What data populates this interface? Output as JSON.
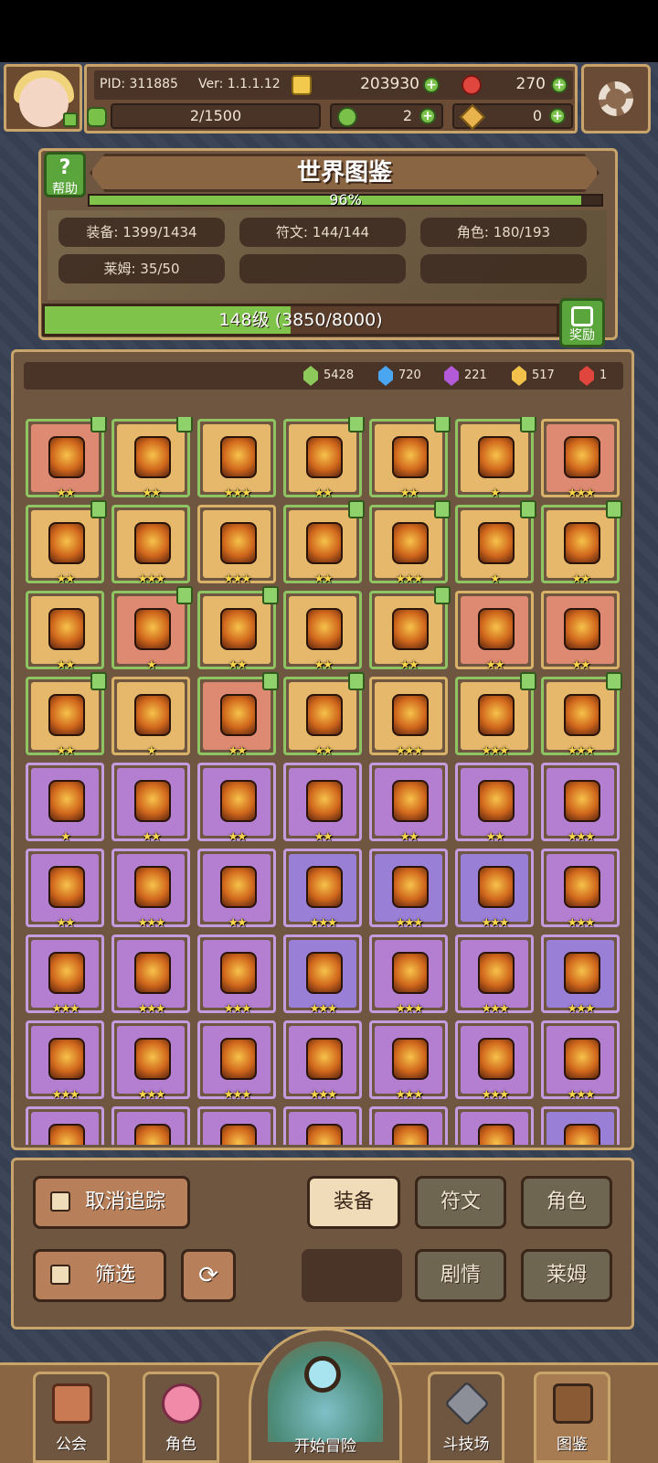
{
  "hud": {
    "pid": "PID: 311885",
    "version": "Ver: 1.1.1.12",
    "gold": "203930",
    "ruby": "270",
    "energy": "2/1500",
    "clover": "2",
    "keys": "0"
  },
  "encyclopedia": {
    "title": "世界图鉴",
    "help_label": "帮助",
    "completion": "96%",
    "completion_value": 0.96,
    "stats": {
      "equipment": "装备: 1399/1434",
      "runes": "符文: 144/144",
      "characters": "角色: 180/193",
      "slime": "莱姆: 35/50"
    },
    "level_text": "148级  (3850/8000)",
    "level_progress": 0.48,
    "reward_label": "奖励"
  },
  "shards": [
    {
      "name": "green-shard",
      "value": "5428",
      "color": "#8dc85a"
    },
    {
      "name": "blue-shard",
      "value": "720",
      "color": "#4aa6f0"
    },
    {
      "name": "purple-shard",
      "value": "221",
      "color": "#b35ad8"
    },
    {
      "name": "gold-shard",
      "value": "517",
      "color": "#f2c14a"
    },
    {
      "name": "red-shard",
      "value": "1",
      "color": "#e0463d"
    }
  ],
  "grid": {
    "rows": [
      [
        {
          "bg": "red",
          "bd": "green",
          "stars": "★★",
          "tag": true
        },
        {
          "bg": "gold",
          "bd": "green",
          "stars": "★★",
          "tag": true
        },
        {
          "bg": "gold",
          "bd": "green",
          "stars": "★★★",
          "tag": false
        },
        {
          "bg": "gold",
          "bd": "green",
          "stars": "★★",
          "tag": true
        },
        {
          "bg": "gold",
          "bd": "green",
          "stars": "★★",
          "tag": true
        },
        {
          "bg": "gold",
          "bd": "green",
          "stars": "★",
          "tag": true
        },
        {
          "bg": "red",
          "bd": "gold",
          "stars": "★★★",
          "tag": false
        }
      ],
      [
        {
          "bg": "gold",
          "bd": "green",
          "stars": "★★",
          "tag": true
        },
        {
          "bg": "gold",
          "bd": "green",
          "stars": "★★★",
          "tag": false
        },
        {
          "bg": "gold",
          "bd": "gold",
          "stars": "★★★",
          "tag": false
        },
        {
          "bg": "gold",
          "bd": "green",
          "stars": "★★",
          "tag": true
        },
        {
          "bg": "gold",
          "bd": "green",
          "stars": "★★★",
          "tag": true
        },
        {
          "bg": "gold",
          "bd": "green",
          "stars": "★",
          "tag": true
        },
        {
          "bg": "gold",
          "bd": "green",
          "stars": "★★",
          "tag": true
        }
      ],
      [
        {
          "bg": "gold",
          "bd": "green",
          "stars": "★★",
          "tag": false
        },
        {
          "bg": "red",
          "bd": "green",
          "stars": "★",
          "tag": true
        },
        {
          "bg": "gold",
          "bd": "green",
          "stars": "★★",
          "tag": true
        },
        {
          "bg": "gold",
          "bd": "green",
          "stars": "★★",
          "tag": false
        },
        {
          "bg": "gold",
          "bd": "green",
          "stars": "★★",
          "tag": true
        },
        {
          "bg": "red",
          "bd": "gold",
          "stars": "★★",
          "tag": false
        },
        {
          "bg": "red",
          "bd": "gold",
          "stars": "★★",
          "tag": false
        }
      ],
      [
        {
          "bg": "gold",
          "bd": "green",
          "stars": "★★",
          "tag": true
        },
        {
          "bg": "gold",
          "bd": "gold",
          "stars": "★",
          "tag": false
        },
        {
          "bg": "red",
          "bd": "green",
          "stars": "★★",
          "tag": true
        },
        {
          "bg": "gold",
          "bd": "green",
          "stars": "★★",
          "tag": true
        },
        {
          "bg": "gold",
          "bd": "gold",
          "stars": "★★★",
          "tag": false
        },
        {
          "bg": "gold",
          "bd": "green",
          "stars": "★★★",
          "tag": true
        },
        {
          "bg": "gold",
          "bd": "green",
          "stars": "★★★",
          "tag": true
        }
      ],
      [
        {
          "bg": "purple",
          "bd": "purple",
          "stars": "★",
          "tag": false
        },
        {
          "bg": "purple",
          "bd": "purple",
          "stars": "★★",
          "tag": false
        },
        {
          "bg": "purple",
          "bd": "purple",
          "stars": "★★",
          "tag": false
        },
        {
          "bg": "purple",
          "bd": "purple",
          "stars": "★★",
          "tag": false
        },
        {
          "bg": "purple",
          "bd": "purple",
          "stars": "★★",
          "tag": false
        },
        {
          "bg": "purple",
          "bd": "purple",
          "stars": "★★",
          "tag": false
        },
        {
          "bg": "purple",
          "bd": "purple",
          "stars": "★★★",
          "tag": false
        }
      ],
      [
        {
          "bg": "purple",
          "bd": "purple",
          "stars": "★★",
          "tag": false
        },
        {
          "bg": "purple",
          "bd": "purple",
          "stars": "★★★",
          "tag": false
        },
        {
          "bg": "purple",
          "bd": "purple",
          "stars": "★★",
          "tag": false
        },
        {
          "bg": "violet",
          "bd": "purple",
          "stars": "★★★",
          "tag": false
        },
        {
          "bg": "violet",
          "bd": "purple",
          "stars": "★★★",
          "tag": false
        },
        {
          "bg": "violet",
          "bd": "purple",
          "stars": "★★★",
          "tag": false
        },
        {
          "bg": "purple",
          "bd": "purple",
          "stars": "★★★",
          "tag": false
        }
      ],
      [
        {
          "bg": "purple",
          "bd": "purple",
          "stars": "★★★",
          "tag": false
        },
        {
          "bg": "purple",
          "bd": "purple",
          "stars": "★★★",
          "tag": false
        },
        {
          "bg": "purple",
          "bd": "purple",
          "stars": "★★★",
          "tag": false
        },
        {
          "bg": "violet",
          "bd": "purple",
          "stars": "★★★",
          "tag": false
        },
        {
          "bg": "purple",
          "bd": "purple",
          "stars": "★★★",
          "tag": false
        },
        {
          "bg": "purple",
          "bd": "purple",
          "stars": "★★★",
          "tag": false
        },
        {
          "bg": "violet",
          "bd": "purple",
          "stars": "★★★",
          "tag": false
        }
      ],
      [
        {
          "bg": "purple",
          "bd": "purple",
          "stars": "★★★",
          "tag": false
        },
        {
          "bg": "purple",
          "bd": "purple",
          "stars": "★★★",
          "tag": false
        },
        {
          "bg": "purple",
          "bd": "purple",
          "stars": "★★★",
          "tag": false
        },
        {
          "bg": "purple",
          "bd": "purple",
          "stars": "★★★",
          "tag": false
        },
        {
          "bg": "purple",
          "bd": "purple",
          "stars": "★★★",
          "tag": false
        },
        {
          "bg": "purple",
          "bd": "purple",
          "stars": "★★★",
          "tag": false
        },
        {
          "bg": "purple",
          "bd": "purple",
          "stars": "★★★",
          "tag": false
        }
      ],
      [
        {
          "bg": "purple",
          "bd": "purple",
          "stars": "",
          "tag": false
        },
        {
          "bg": "purple",
          "bd": "purple",
          "stars": "",
          "tag": false
        },
        {
          "bg": "purple",
          "bd": "purple",
          "stars": "",
          "tag": false
        },
        {
          "bg": "purple",
          "bd": "purple",
          "stars": "",
          "tag": false
        },
        {
          "bg": "purple",
          "bd": "purple",
          "stars": "",
          "tag": false
        },
        {
          "bg": "purple",
          "bd": "purple",
          "stars": "",
          "tag": false
        },
        {
          "bg": "violet",
          "bd": "purple",
          "stars": "",
          "tag": false
        }
      ]
    ]
  },
  "controls": {
    "untrack": "取消追踪",
    "filter": "筛选",
    "tab_equipment": "装备",
    "tab_runes": "符文",
    "tab_characters": "角色",
    "tab_story": "剧情",
    "tab_slime": "莱姆"
  },
  "nav": {
    "guild": "公会",
    "characters": "角色",
    "adventure": "开始冒险",
    "arena": "斗技场",
    "codex": "图鉴"
  }
}
